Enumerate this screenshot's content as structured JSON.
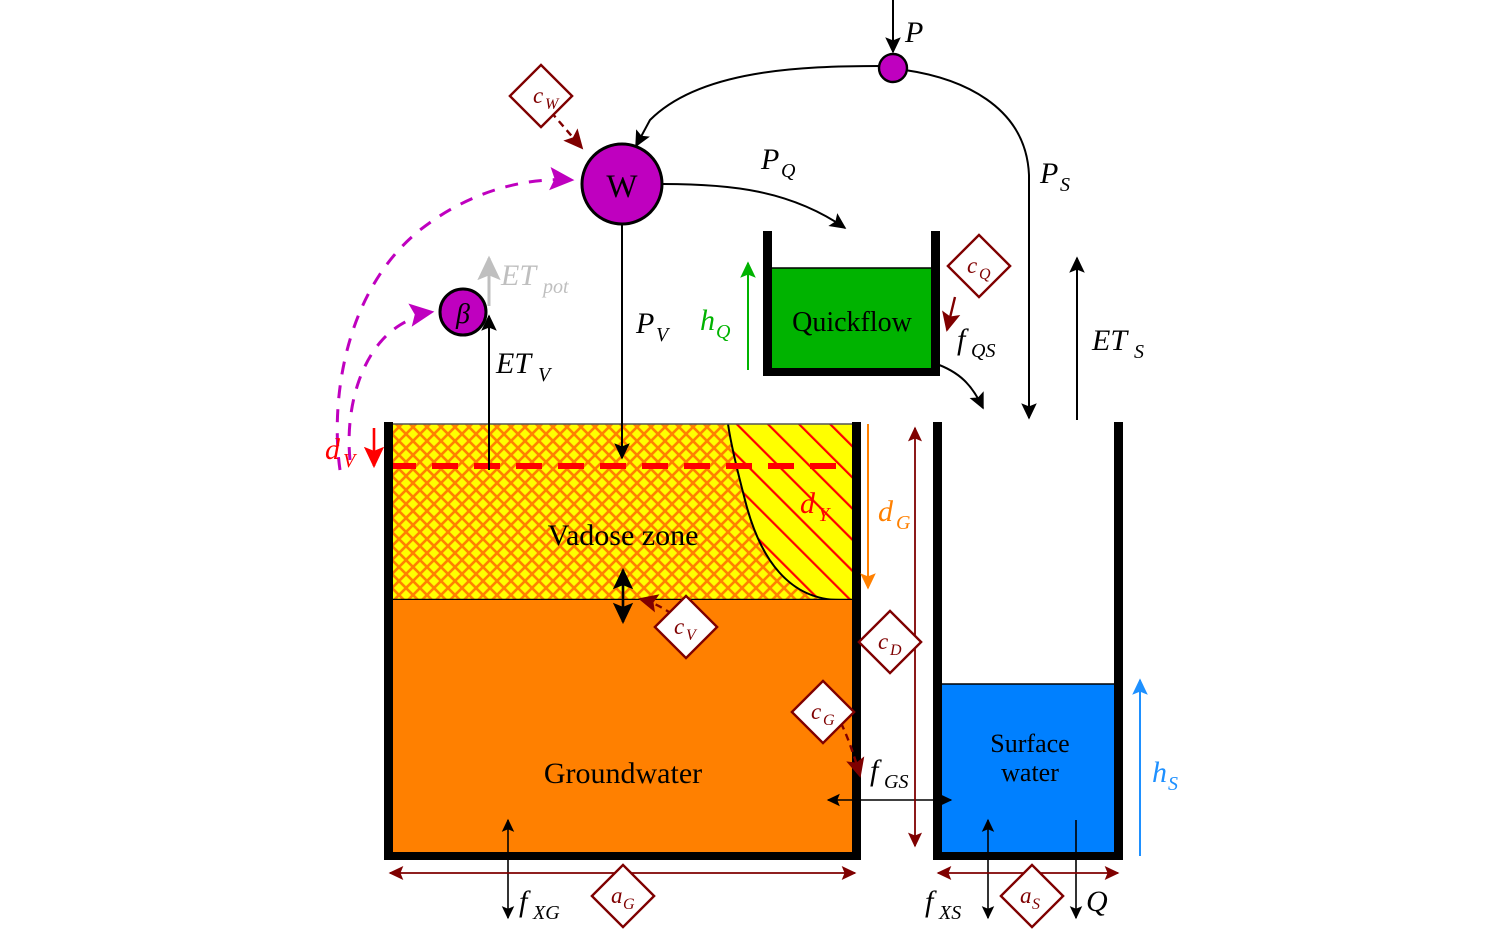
{
  "title": "Conceptual hydrological model with vadose zone, groundwater, quickflow and surface water stores",
  "colors": {
    "magenta": "#BF00BF",
    "darkred": "#7F0000",
    "red": "#FF0000",
    "orange": "#FF8000",
    "yellow": "#FFFF00",
    "green": "#00B300",
    "blue": "#0080FF",
    "grey": "#BFBFBF",
    "black": "#000000",
    "white": "#FFFFFF"
  },
  "stores": {
    "vadose": {
      "label": "Vadose zone",
      "fill": "#FFFF00",
      "hatch": "#FF8000"
    },
    "groundwater": {
      "label": "Groundwater",
      "fill": "#FF8000"
    },
    "quickflow": {
      "label": "Quickflow",
      "fill": "#00B300"
    },
    "surface_water": {
      "label_line1": "Surface",
      "label_line2": "water",
      "fill": "#0080FF"
    }
  },
  "nodes": [
    {
      "name": "precipitation-node",
      "label": "",
      "fill": "#BF00BF"
    },
    {
      "name": "w-node",
      "label": "W",
      "fill": "#BF00BF"
    },
    {
      "name": "beta-node",
      "label": "β",
      "fill": "#BF00BF"
    }
  ],
  "flux_labels": {
    "P": "P",
    "P_Q": "P",
    "P_Q_sub": "Q",
    "P_S": "P",
    "P_S_sub": "S",
    "P_V": "P",
    "P_V_sub": "V",
    "ET_pot": "ET",
    "ET_pot_sub": "pot",
    "ET_V": "ET",
    "ET_V_sub": "V",
    "ET_S": "ET",
    "ET_S_sub": "S",
    "f_QS": "f",
    "f_QS_sub": "QS",
    "f_GS": "f",
    "f_GS_sub": "GS",
    "f_XG": "f",
    "f_XG_sub": "XG",
    "f_XS": "f",
    "f_XS_sub": "XS",
    "Q": "Q"
  },
  "state_labels": {
    "h_Q": "h",
    "h_Q_sub": "Q",
    "h_S": "h",
    "h_S_sub": "S",
    "d_V_left": "d",
    "d_V_left_sub": "V",
    "d_Y": "d",
    "d_Y_sub": "Y",
    "d_G": "d",
    "d_G_sub": "G"
  },
  "parameter_diamonds": [
    {
      "name": "c-w-diamond",
      "main": "c",
      "sub": "W"
    },
    {
      "name": "c-q-diamond",
      "main": "c",
      "sub": "Q"
    },
    {
      "name": "c-v-diamond",
      "main": "c",
      "sub": "V"
    },
    {
      "name": "c-g-diamond",
      "main": "c",
      "sub": "G"
    },
    {
      "name": "c-d-diamond",
      "main": "c",
      "sub": "D"
    },
    {
      "name": "a-g-diamond",
      "main": "a",
      "sub": "G"
    },
    {
      "name": "a-s-diamond",
      "main": "a",
      "sub": "S"
    }
  ]
}
